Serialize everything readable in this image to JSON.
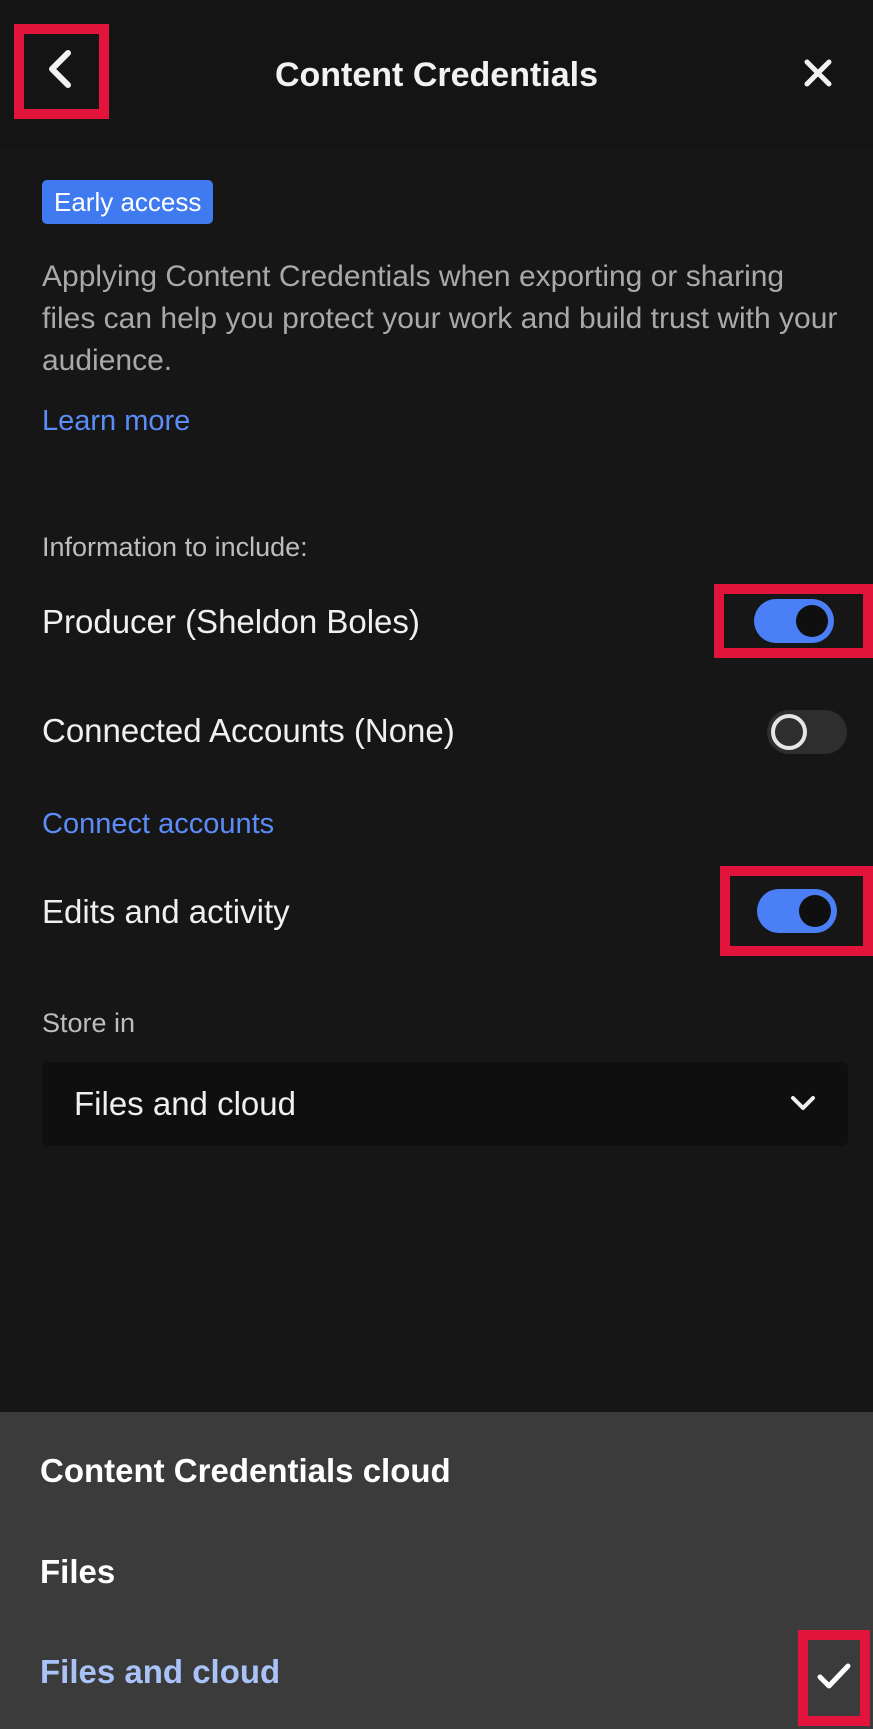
{
  "header": {
    "title": "Content Credentials"
  },
  "badge": "Early access",
  "description": "Applying Content Credentials when exporting or sharing files can help you protect your work and build trust with your audience.",
  "learn_more": "Learn more",
  "info_label": "Information to include:",
  "rows": [
    {
      "label": "Producer (Sheldon Boles)",
      "enabled": true
    },
    {
      "label": "Connected Accounts (None)",
      "enabled": false
    },
    {
      "label": "Edits and activity",
      "enabled": true
    }
  ],
  "connect_accounts": "Connect accounts",
  "store_in": {
    "label": "Store in",
    "value": "Files and cloud"
  },
  "options": [
    {
      "label": "Content Credentials cloud",
      "selected": false
    },
    {
      "label": "Files",
      "selected": false
    },
    {
      "label": "Files and cloud",
      "selected": true
    }
  ],
  "colors": {
    "accent": "#4a7ff5",
    "link": "#5b8cf7",
    "highlight": "#e3143c",
    "selected_text": "#a9c2f7"
  }
}
